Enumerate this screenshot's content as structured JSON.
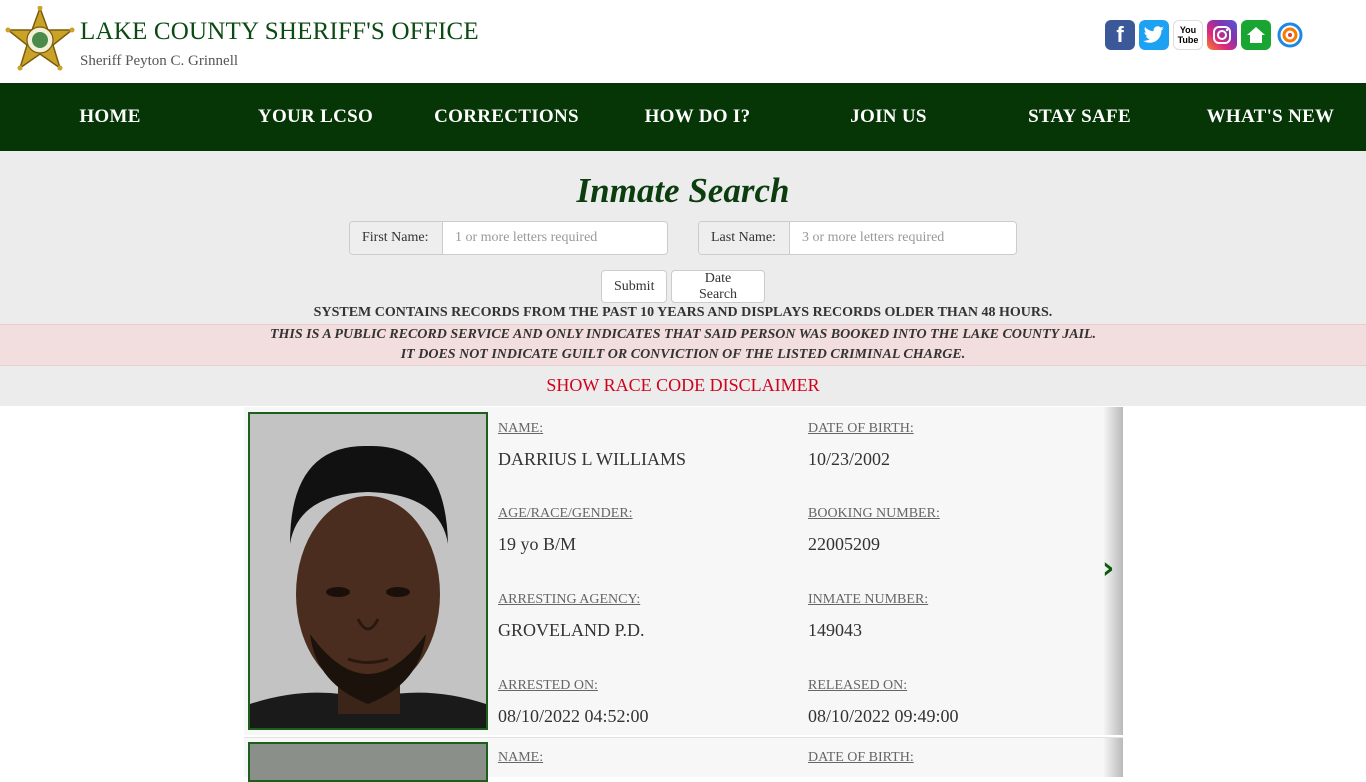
{
  "header": {
    "office_title": "LAKE COUNTY SHERIFF'S OFFICE",
    "sheriff_name": "Sheriff Peyton C. Grinnell",
    "social_icons": [
      "facebook-icon",
      "twitter-icon",
      "youtube-icon",
      "instagram-icon",
      "nextdoor-icon",
      "crimereports-icon"
    ],
    "youtube_text": "You Tube"
  },
  "nav": {
    "items": [
      "HOME",
      "YOUR LCSO",
      "CORRECTIONS",
      "HOW DO I?",
      "JOIN US",
      "STAY SAFE",
      "WHAT'S NEW"
    ]
  },
  "search": {
    "title": "Inmate Search",
    "first_name_label": "First Name:",
    "first_name_placeholder": "1 or more letters required",
    "last_name_label": "Last Name:",
    "last_name_placeholder": "3 or more letters required",
    "submit_label": "Submit",
    "date_search_label": "Date Search",
    "system_note": "SYSTEM CONTAINS RECORDS FROM THE PAST 10 YEARS AND DISPLAYS RECORDS OLDER THAN 48 HOURS.",
    "disclaimer_line1": "THIS IS A PUBLIC RECORD SERVICE AND ONLY INDICATES THAT SAID PERSON WAS BOOKED INTO THE LAKE COUNTY JAIL.",
    "disclaimer_line2": "IT DOES NOT INDICATE GUILT OR CONVICTION OF THE LISTED CRIMINAL CHARGE.",
    "race_code_link": "SHOW RACE CODE DISCLAIMER"
  },
  "records": [
    {
      "name_label": "NAME:",
      "name": "DARRIUS L WILLIAMS",
      "dob_label": "DATE OF BIRTH:",
      "dob": "10/23/2002",
      "arg_label": "AGE/RACE/GENDER:",
      "arg": "19 yo B/M",
      "booking_label": "BOOKING NUMBER:",
      "booking": "22005209",
      "agency_label": "ARRESTING AGENCY:",
      "agency": "GROVELAND P.D.",
      "inmate_label": "INMATE NUMBER:",
      "inmate": "149043",
      "arrested_label": "ARRESTED ON:",
      "arrested": "08/10/2022 04:52:00",
      "released_label": "RELEASED ON:",
      "released": "08/10/2022 09:49:00"
    },
    {
      "name_label": "NAME:",
      "dob_label": "DATE OF BIRTH:"
    }
  ],
  "colors": {
    "nav_bg": "#063606",
    "title_green": "#0b3d0e",
    "disclaimer_bg": "#f2dede",
    "link_red": "#d0021b"
  }
}
